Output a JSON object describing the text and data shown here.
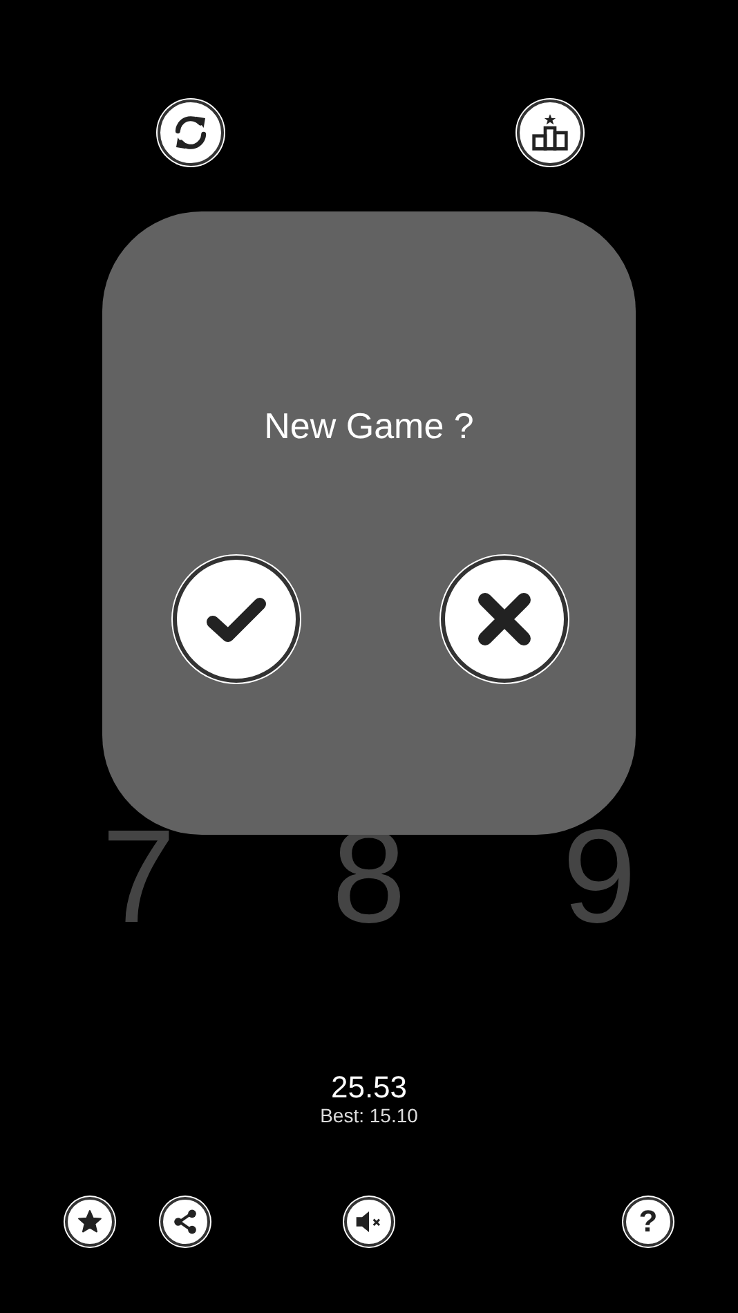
{
  "top_buttons": [
    {
      "kind": "restart"
    },
    {
      "kind": "leaderboard"
    }
  ],
  "board": {
    "tiles": [
      "7",
      "8",
      "9"
    ]
  },
  "dialog": {
    "title": "New Game ?",
    "buttons": [
      {
        "kind": "confirm"
      },
      {
        "kind": "cancel"
      }
    ]
  },
  "score": {
    "time": "25.53",
    "best": "Best: 15.10"
  },
  "bottom_buttons": [
    {
      "kind": "rate"
    },
    {
      "kind": "share"
    },
    {
      "kind": "sound",
      "muted": true
    },
    {
      "kind": "help",
      "label": "?"
    }
  ]
}
